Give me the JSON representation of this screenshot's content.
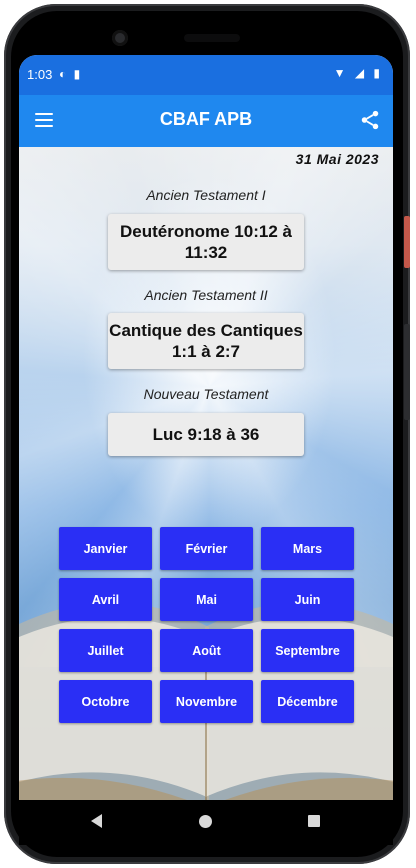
{
  "status_bar": {
    "time": "1:03",
    "left_icons": [
      "app-notification-icon",
      "sd-card-icon"
    ],
    "right_icons": [
      "wifi-icon",
      "signal-icon",
      "battery-icon"
    ]
  },
  "app_bar": {
    "title": "CBAF APB",
    "left_icon": "menu-icon",
    "right_icon": "share-icon",
    "color": "#1f88ef"
  },
  "date": "31  Mai  2023",
  "readings": [
    {
      "label": "Ancien Testament I",
      "text": "Deutéronome 10:12 à 11:32"
    },
    {
      "label": "Ancien Testament II",
      "text": "Cantique des Cantiques 1:1 à 2:7"
    },
    {
      "label": "Nouveau Testament",
      "text": "Luc 9:18 à 36"
    }
  ],
  "months": [
    "Janvier",
    "Février",
    "Mars",
    "Avril",
    "Mai",
    "Juin",
    "Juillet",
    "Août",
    "Septembre",
    "Octobre",
    "Novembre",
    "Décembre"
  ],
  "month_button_color": "#2a2ff5",
  "nav_bar": {
    "icons": [
      "back-icon",
      "home-icon",
      "recent-apps-icon"
    ]
  }
}
